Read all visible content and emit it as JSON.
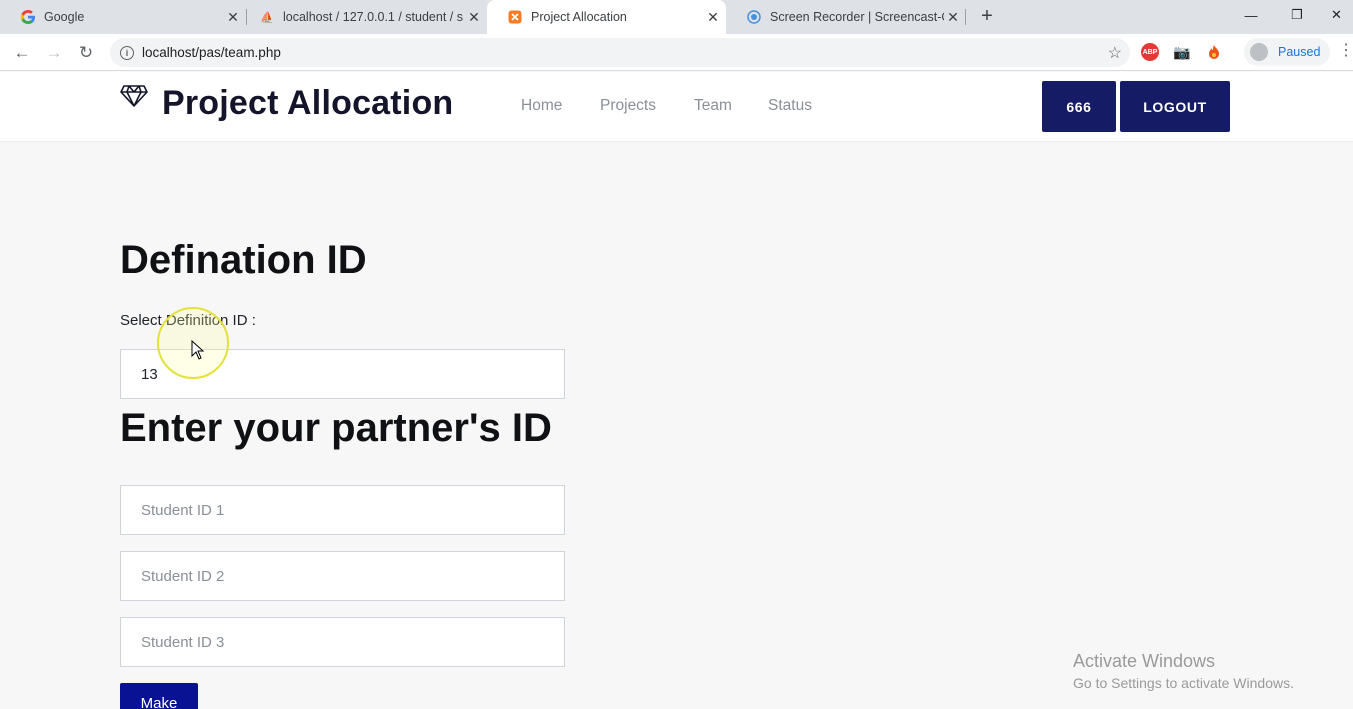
{
  "browser": {
    "tabs": [
      {
        "title": "Google",
        "favicon": "google-icon"
      },
      {
        "title": "localhost / 127.0.0.1 / student / s",
        "favicon": "phpmyadmin-icon"
      },
      {
        "title": "Project Allocation",
        "favicon": "xampp-icon"
      },
      {
        "title": "Screen Recorder | Screencast-O-",
        "favicon": "screencast-icon"
      }
    ],
    "address": "localhost/pas/team.php",
    "profile_label": "Paused",
    "extensions": [
      "adblock-icon",
      "camera-icon",
      "fire-icon"
    ]
  },
  "site": {
    "brand": "Project Allocation",
    "nav": [
      "Home",
      "Projects",
      "Team",
      "Status"
    ],
    "user_button": "666",
    "logout_button": "LOGOUT"
  },
  "form": {
    "definition_heading": "Defination ID",
    "definition_label": "Select Definition ID :",
    "definition_value": "13",
    "partner_heading": "Enter your partner's ID",
    "student_placeholders": [
      "Student ID 1",
      "Student ID 2",
      "Student ID 3"
    ],
    "submit_label": "Make"
  },
  "watermark": {
    "line1": "Activate Windows",
    "line2": "Go to Settings to activate Windows."
  },
  "colors": {
    "button_bg": "#151b64",
    "submit_bg": "#0a1294",
    "accent_tab": "#e8710a"
  }
}
